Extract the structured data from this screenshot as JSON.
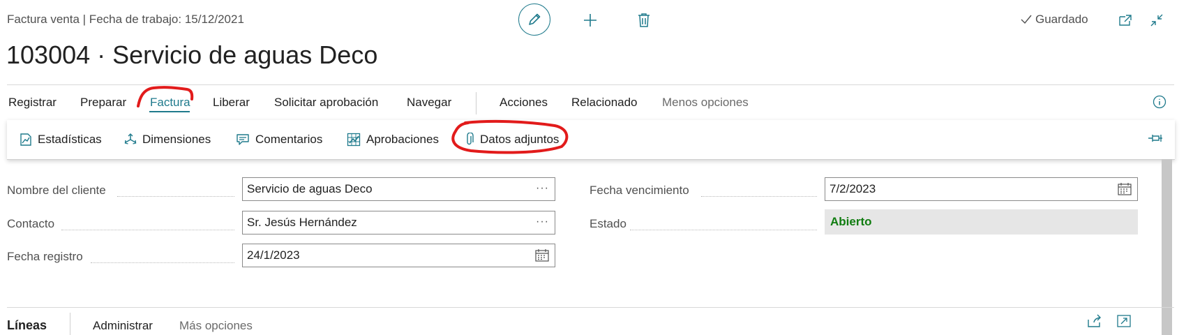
{
  "header": {
    "subtitle": "Factura venta | Fecha de trabajo: 15/12/2021",
    "title": "103004 · Servicio de aguas Deco",
    "saved_label": "Guardado"
  },
  "icons": {
    "edit": "pencil-icon",
    "add": "plus-icon",
    "delete": "trash-icon",
    "saved": "check-icon",
    "open_new": "open-new-window-icon",
    "collapse": "collapse-icon",
    "info": "info-icon",
    "pin": "pin-icon",
    "share": "share-icon",
    "expand": "expand-icon"
  },
  "menu": {
    "items": [
      "Registrar",
      "Preparar",
      "Factura",
      "Liberar",
      "Solicitar aprobación",
      "Navegar",
      "Acciones",
      "Relacionado",
      "Menos opciones"
    ],
    "active": "Factura"
  },
  "submenu": {
    "items": [
      "Estadísticas",
      "Dimensiones",
      "Comentarios",
      "Aprobaciones",
      "Datos adjuntos"
    ]
  },
  "form": {
    "customer_name_label": "Nombre del cliente",
    "customer_name_value": "Servicio de aguas Deco",
    "contact_label": "Contacto",
    "contact_value": "Sr. Jesús Hernández",
    "posting_date_label": "Fecha registro",
    "posting_date_value": "24/1/2023",
    "due_date_label": "Fecha vencimiento",
    "due_date_value": "7/2/2023",
    "status_label": "Estado",
    "status_value": "Abierto",
    "ellipsis": "···"
  },
  "lines": {
    "title": "Líneas",
    "manage": "Administrar",
    "more": "Más opciones"
  },
  "colors": {
    "accent": "#1f7a8c",
    "status_open": "#107c10",
    "annotation": "#e21b1b"
  }
}
